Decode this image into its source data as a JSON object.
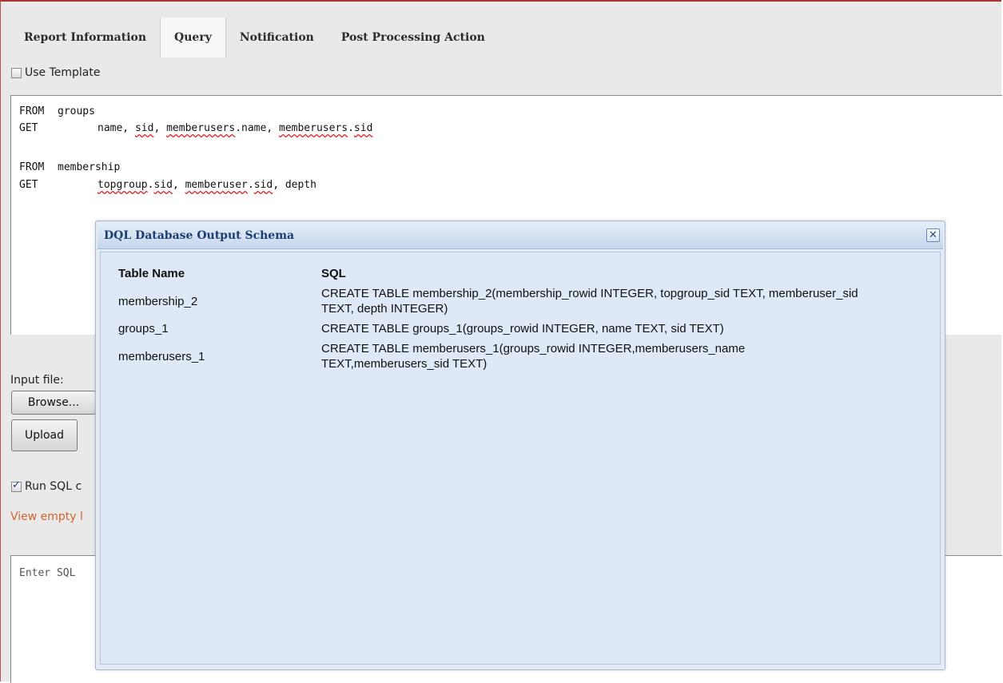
{
  "tabs": [
    {
      "label": "Report Information",
      "active": false
    },
    {
      "label": "Query",
      "active": true
    },
    {
      "label": "Notification",
      "active": false
    },
    {
      "label": "Post Processing Action",
      "active": false
    }
  ],
  "use_template": {
    "label": "Use Template",
    "checked": false
  },
  "query": {
    "line1": {
      "keyword": "FROM",
      "arg": "groups"
    },
    "line2": {
      "keyword": "GET",
      "arg_parts": [
        "name, ",
        "sid",
        ", ",
        "memberusers",
        ".name, ",
        "memberusers",
        ".",
        "sid"
      ]
    },
    "line3": {
      "keyword": "FROM",
      "arg": "membership"
    },
    "line4": {
      "keyword": "GET",
      "arg_parts": [
        "topgroup",
        ".",
        "sid",
        ", ",
        "memberuser",
        ".",
        "sid",
        ", depth"
      ]
    }
  },
  "input_file": {
    "label": "Input file:",
    "browse_label": "Browse...",
    "upload_label": "Upload"
  },
  "run_sql": {
    "label": "Run SQL c",
    "checked": true
  },
  "view_empty_link": "View empty l",
  "sql_placeholder": "Enter SQL",
  "dialog": {
    "title": "DQL Database Output Schema",
    "close_symbol": "✕",
    "headers": {
      "table_name": "Table Name",
      "sql": "SQL"
    },
    "rows": [
      {
        "table": "membership_2",
        "sql": "CREATE TABLE membership_2(membership_rowid INTEGER, topgroup_sid TEXT, memberuser_sid TEXT, depth INTEGER)"
      },
      {
        "table": "groups_1",
        "sql": "CREATE TABLE groups_1(groups_rowid INTEGER, name TEXT, sid TEXT)"
      },
      {
        "table": "memberusers_1",
        "sql": "CREATE TABLE memberusers_1(groups_rowid INTEGER,memberusers_name TEXT,memberusers_sid TEXT)"
      }
    ]
  },
  "colors": {
    "accent_border": "#aa3333",
    "link": "#d0642e",
    "dialog_title": "#1b3d72"
  }
}
